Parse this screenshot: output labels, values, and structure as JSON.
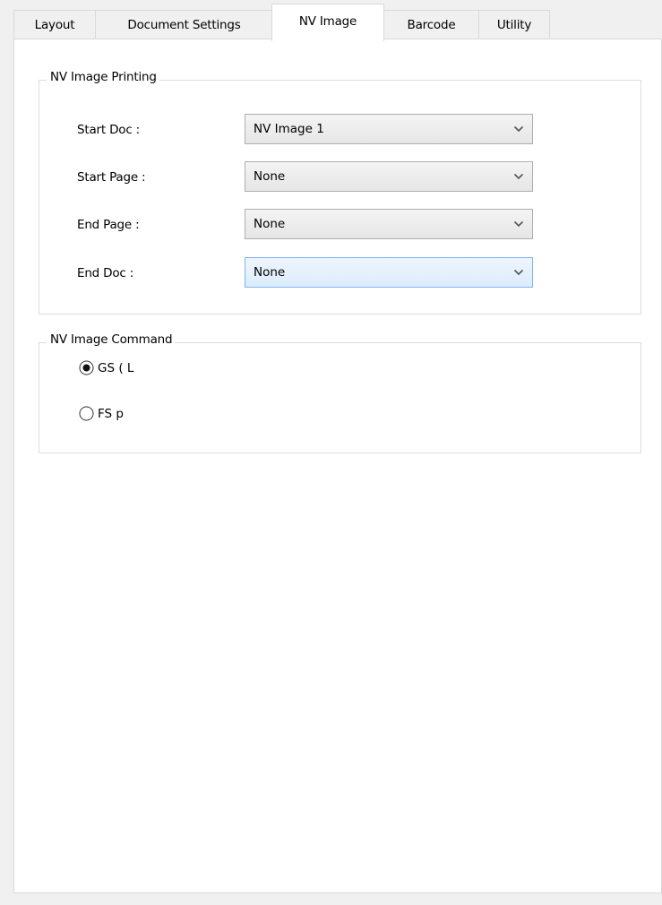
{
  "tabs": [
    {
      "label": "Layout",
      "active": false
    },
    {
      "label": "Document Settings",
      "active": false
    },
    {
      "label": "NV Image",
      "active": true
    },
    {
      "label": "Barcode",
      "active": false
    },
    {
      "label": "Utility",
      "active": false
    }
  ],
  "nv_image_printing": {
    "title": "NV Image Printing",
    "start_doc": {
      "label": "Start Doc :",
      "value": "NV Image 1"
    },
    "start_page": {
      "label": "Start Page :",
      "value": "None"
    },
    "end_page": {
      "label": "End Page :",
      "value": "None"
    },
    "end_doc": {
      "label": "End Doc :",
      "value": "None"
    },
    "icons": {
      "dropdown": "chevron-down-icon"
    }
  },
  "nv_image_command": {
    "title": "NV Image Command",
    "options": [
      {
        "label": "GS ( L",
        "selected": true
      },
      {
        "label": "FS p",
        "selected": false
      }
    ]
  },
  "colors": {
    "accent_focus": "#7eb4ea",
    "panel_bg": "#ffffff",
    "window_bg": "#f0f0f0"
  }
}
